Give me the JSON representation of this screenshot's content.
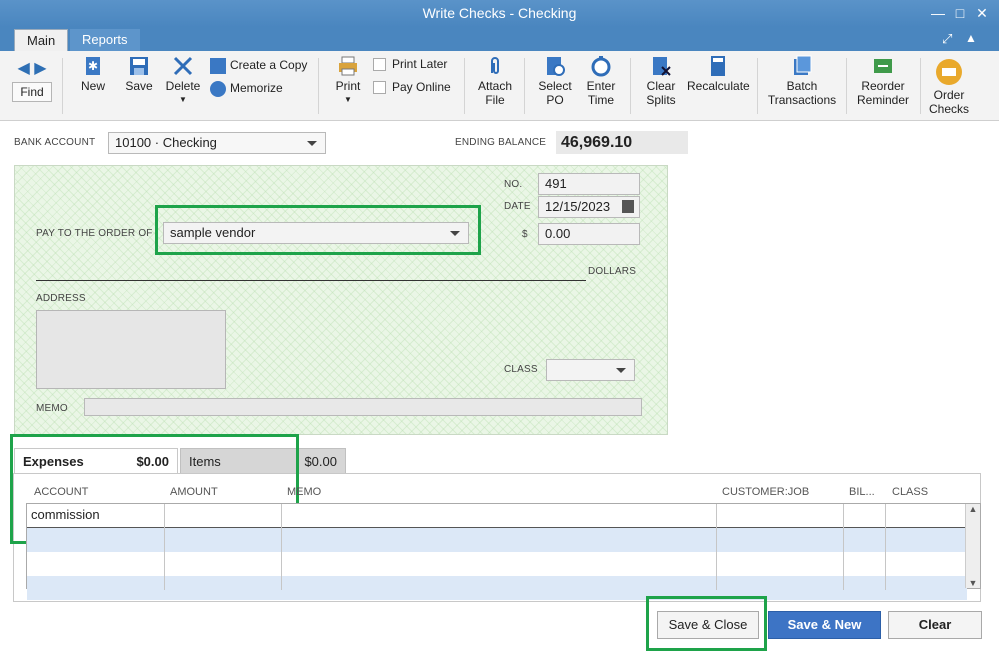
{
  "window": {
    "title": "Write Checks - Checking"
  },
  "tabs": {
    "main": "Main",
    "reports": "Reports"
  },
  "toolbar": {
    "find": "Find",
    "new": "New",
    "save": "Save",
    "delete": "Delete",
    "create_copy": "Create a Copy",
    "memorize": "Memorize",
    "print": "Print",
    "print_later": "Print Later",
    "pay_online": "Pay Online",
    "attach_file_1": "Attach",
    "attach_file_2": "File",
    "select_po_1": "Select",
    "select_po_2": "PO",
    "enter_time_1": "Enter",
    "enter_time_2": "Time",
    "clear_splits_1": "Clear",
    "clear_splits_2": "Splits",
    "recalculate": "Recalculate",
    "batch_1": "Batch",
    "batch_2": "Transactions",
    "reorder_1": "Reorder",
    "reorder_2": "Reminder",
    "order_checks_1": "Order",
    "order_checks_2": "Checks"
  },
  "form": {
    "bank_account_label": "BANK ACCOUNT",
    "bank_account_value": "10100 · Checking",
    "ending_balance_label": "ENDING BALANCE",
    "ending_balance_value": "46,969.10",
    "no_label": "NO.",
    "no_value": "491",
    "date_label": "DATE",
    "date_value": "12/15/2023",
    "pay_to_label": "PAY TO THE ORDER OF",
    "pay_to_value": "sample vendor",
    "amount_label": "$",
    "amount_value": "0.00",
    "dollars_label": "DOLLARS",
    "address_label": "ADDRESS",
    "class_label": "CLASS",
    "memo_label": "MEMO"
  },
  "lower_tabs": {
    "expenses_label": "Expenses",
    "expenses_amount": "$0.00",
    "items_label": "Items",
    "items_amount": "$0.00"
  },
  "grid": {
    "headers": [
      "ACCOUNT",
      "AMOUNT",
      "MEMO",
      "CUSTOMER:JOB",
      "BIL...",
      "CLASS"
    ],
    "rows": [
      {
        "account": "commission",
        "amount": "",
        "memo": "",
        "customer_job": "",
        "billable": "",
        "class": ""
      }
    ]
  },
  "buttons": {
    "save_close": "Save & Close",
    "save_new": "Save & New",
    "clear": "Clear"
  },
  "colors": {
    "titlebar": "#4a86bf",
    "highlight": "#1ea34a",
    "primary_button": "#3d74c5",
    "check_bg": "#eaf6e6"
  }
}
